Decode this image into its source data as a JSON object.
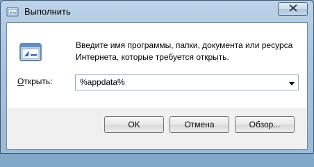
{
  "window": {
    "title": "Выполнить"
  },
  "dialog": {
    "description": "Введите имя программы, папки, документа или ресурса Интернета, которые требуется открыть.",
    "open_label_access": "О",
    "open_label_rest": "ткрыть:",
    "input_value": "%appdata%"
  },
  "buttons": {
    "ok": "OK",
    "cancel": "Отмена",
    "browse": "Обзор..."
  },
  "icons": {
    "title": "run-icon",
    "dialog": "run-icon",
    "close": "close-icon",
    "dropdown": "chevron-down-icon"
  },
  "colors": {
    "frame": "#a9c4de",
    "client_bg": "#ffffff",
    "footer_bg": "#f0f0f0"
  }
}
